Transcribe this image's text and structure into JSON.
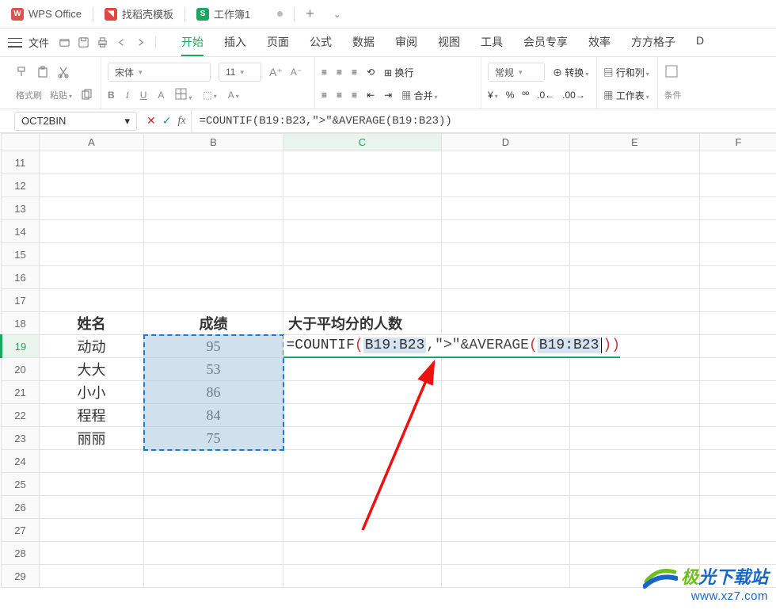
{
  "titlebar": {
    "app_name": "WPS Office",
    "tab_doc": "找稻壳模板",
    "tab_sheet": "工作簿1",
    "sheet_badge": "S",
    "plus": "+",
    "more": "⌄"
  },
  "menubar": {
    "file_label": "文件",
    "tabs": [
      "开始",
      "插入",
      "页面",
      "公式",
      "数据",
      "审阅",
      "视图",
      "工具",
      "会员专享",
      "效率",
      "方方格子",
      "D"
    ]
  },
  "ribbon": {
    "format_painter": "格式刷",
    "paste": "粘贴",
    "font_name": "宋体",
    "font_size": "11",
    "bold": "B",
    "italic": "I",
    "underline": "U",
    "strike": "A",
    "wrap": "换行",
    "merge": "合并",
    "numfmt": "常规",
    "convert": "转换",
    "rowcol": "行和列",
    "worksheet": "工作表",
    "condfmt": "条件"
  },
  "formulabar": {
    "namebox": "OCT2BIN",
    "formula": "=COUNTIF(B19:B23,\">\"&AVERAGE(B19:B23))"
  },
  "grid": {
    "cols": [
      "A",
      "B",
      "C",
      "D",
      "E",
      "F"
    ],
    "row_start": 11,
    "row_end": 29,
    "active_row": 19,
    "active_col": "C",
    "headers": {
      "A18": "姓名",
      "B18": "成绩",
      "C18": "大于平均分的人数"
    },
    "data": {
      "A19": "动动",
      "B19": "95",
      "A20": "大大",
      "B20": "53",
      "A21": "小小",
      "B21": "86",
      "A22": "程程",
      "B22": "84",
      "A23": "丽丽",
      "B23": "75"
    },
    "formula_display": {
      "prefix": "=COUNTIF",
      "range1": "B19:B23",
      "mid": ",\">\"&AVERAGE",
      "range2": "B19:B23"
    }
  },
  "chart_data": {
    "type": "table",
    "title": "成绩",
    "columns": [
      "姓名",
      "成绩"
    ],
    "rows": [
      {
        "姓名": "动动",
        "成绩": 95
      },
      {
        "姓名": "大大",
        "成绩": 53
      },
      {
        "姓名": "小小",
        "成绩": 86
      },
      {
        "姓名": "程程",
        "成绩": 84
      },
      {
        "姓名": "丽丽",
        "成绩": 75
      }
    ],
    "derived_label": "大于平均分的人数",
    "derived_formula": "=COUNTIF(B19:B23,\">\"&AVERAGE(B19:B23))"
  },
  "watermark": {
    "brand_head": "极",
    "brand_tail": "光下载站",
    "url": "www.xz7.com"
  }
}
